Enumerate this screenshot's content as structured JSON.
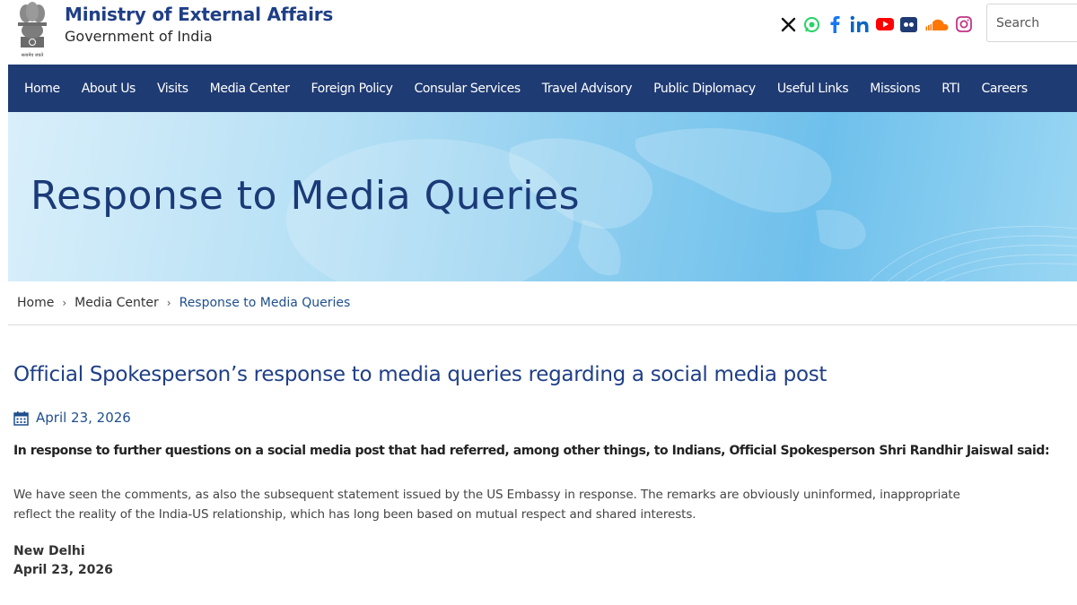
{
  "header": {
    "title": "Ministry of External Affairs",
    "subtitle": "Government of India",
    "emblem_motto": "सत्यमेव जयते",
    "search_placeholder": "Search",
    "social": [
      {
        "icon": "x-icon",
        "color": "#111111"
      },
      {
        "icon": "whatsapp-icon",
        "color": "#25d366"
      },
      {
        "icon": "facebook-icon",
        "color": "#1877f2"
      },
      {
        "icon": "linkedin-icon",
        "color": "#0a66c2"
      },
      {
        "icon": "youtube-icon",
        "color": "#ff0000"
      },
      {
        "icon": "flickr-icon",
        "color": "#1f3b73"
      },
      {
        "icon": "soundcloud-icon",
        "color": "#ff7700"
      },
      {
        "icon": "instagram-icon",
        "color": "#c13584"
      }
    ]
  },
  "nav": {
    "items": [
      "Home",
      "About Us",
      "Visits",
      "Media Center",
      "Foreign Policy",
      "Consular Services",
      "Travel Advisory",
      "Public Diplomacy",
      "Useful Links",
      "Missions",
      "RTI",
      "Careers"
    ]
  },
  "banner": {
    "title": "Response to Media Queries"
  },
  "breadcrumb": {
    "items": [
      "Home",
      "Media Center",
      "Response to Media Queries"
    ]
  },
  "article": {
    "title": "Official Spokesperson’s response to media queries regarding a social media post",
    "date": "April 23, 2026",
    "lead": "In response to further questions on a social media post that had referred, among other things, to Indians, Official Spokesperson Shri Randhir Jaiswal said:",
    "body_line1": "We have seen the comments, as also the subsequent statement issued by the US Embassy in response. The remarks are obviously uninformed, inappropriate",
    "body_line2": "reflect the reality of the India-US relationship, which has long been based on mutual respect and shared interests.",
    "place": "New Delhi",
    "place_date": "April 23, 2026"
  },
  "colors": {
    "brand": "#1f3f86",
    "nav_bg": "#1f3b73",
    "link": "#1f4f8e"
  }
}
